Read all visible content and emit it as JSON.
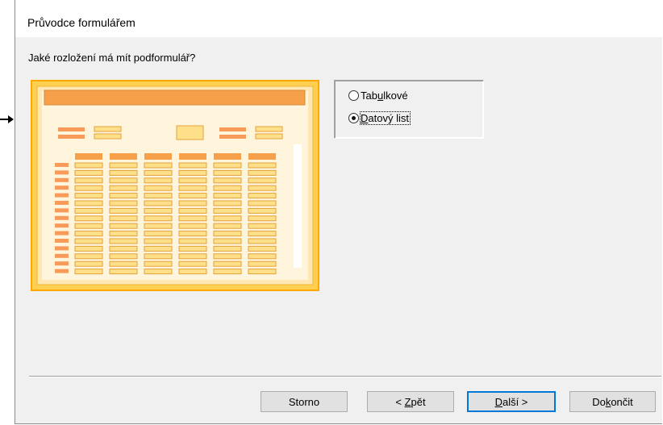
{
  "dialog": {
    "title": "Průvodce formulářem",
    "question": "Jaké rozložení má mít podformulář?"
  },
  "options": [
    {
      "label_pre": "Tab",
      "label_mnemonic": "u",
      "label_post": "lkové",
      "selected": false
    },
    {
      "label_pre": "",
      "label_mnemonic": "D",
      "label_post": "atový list",
      "selected": true
    }
  ],
  "buttons": {
    "cancel": {
      "label": "Storno"
    },
    "back": {
      "label_pre": "< ",
      "label_mnemonic": "Z",
      "label_post": "pět"
    },
    "next": {
      "label_pre": "",
      "label_mnemonic": "D",
      "label_post": "alší >"
    },
    "finish": {
      "label_pre": "Do",
      "label_mnemonic": "k",
      "label_post": "ončit"
    }
  },
  "colors": {
    "accent": "#0078d7",
    "preview_frame": "#ffa800",
    "preview_inner": "#ffe7b3",
    "preview_header": "#f7a04a",
    "preview_cell": "#ffe08a",
    "preview_label": "#f79a5a"
  },
  "icons": {
    "arrow": "arrow-right-icon"
  }
}
